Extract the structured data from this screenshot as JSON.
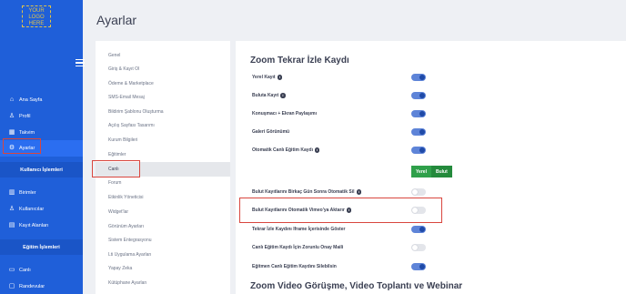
{
  "app": {
    "logo_text": "YOUR LOGO HERE"
  },
  "header": {
    "title": "Ayarlar"
  },
  "sidebar": {
    "items": [
      {
        "label": "Ana Sayfa",
        "icon": "home-icon"
      },
      {
        "label": "Profil",
        "icon": "user-icon"
      },
      {
        "label": "Takvim",
        "icon": "calendar-icon"
      },
      {
        "label": "Ayarlar",
        "icon": "gear-icon",
        "active": true
      }
    ],
    "section1": "Kullanıcı İşlemleri",
    "items2": [
      {
        "label": "Birimler",
        "icon": "building-icon"
      },
      {
        "label": "Kullanıcılar",
        "icon": "users-icon"
      },
      {
        "label": "Kayıt Alanları",
        "icon": "form-icon"
      }
    ],
    "section2": "Eğitim İşlemleri",
    "items3": [
      {
        "label": "Canlı",
        "icon": "video-icon"
      },
      {
        "label": "Randevular",
        "icon": "appointment-icon"
      }
    ]
  },
  "menu": {
    "items": [
      "Genel",
      "Giriş & Kayıt Ol",
      "Ödeme & Marketplace",
      "SMS-Email Mesaj",
      "Bildirim Şablonu Oluşturma",
      "Açılış Sayfası Tasarımı",
      "Kurum Bilgileri",
      "Eğitimler",
      "Canlı",
      "Forum",
      "Etkinlik Yöneticisi",
      "Widget'lar",
      "Görünüm Ayarları",
      "Sistem Entegrasyonu",
      "Lti Uygulama Ayarları",
      "Yapay Zeka",
      "Kütüphane Ayarları"
    ],
    "active": "Canlı"
  },
  "content": {
    "section_title": "Zoom Tekrar İzle Kaydı",
    "settings": [
      {
        "label": "Yerel Kayıt",
        "info": true,
        "on": true
      },
      {
        "label": "Buluta Kayıt",
        "info": true,
        "on": true
      },
      {
        "label": "Konuşmacı + Ekran Paylaşımı",
        "info": false,
        "on": true
      },
      {
        "label": "Galeri Görünümü",
        "info": false,
        "on": true
      },
      {
        "label": "Otomatik Canlı Eğitim Kaydı",
        "info": true,
        "on": true
      }
    ],
    "segment": {
      "option1": "Yerel",
      "option2": "Bulut"
    },
    "settings2": [
      {
        "label": "Bulut Kayıtlarını Birkaç Gün Sonra Otomatik Sil",
        "info": true,
        "on": false
      },
      {
        "label": "Bulut Kayıtlarını Otomatik Vimeo'ya Aktarır",
        "info": true,
        "on": false
      },
      {
        "label": "Tekrar İzle Kaydını Iframe İçerisinde Göster",
        "info": false,
        "on": true
      },
      {
        "label": "Canlı Eğitim Kaydı İçin Zorunlu Onay Maili",
        "info": false,
        "on": false
      },
      {
        "label": "Eğitmen Canlı Eğitim Kaydını Silebilsin",
        "info": false,
        "on": true
      }
    ],
    "section_title2": "Zoom Video Görüşme, Video Toplantı ve Webinar"
  },
  "colors": {
    "sidebar": "#1f5fd9",
    "accent": "#2b6ef0",
    "toggle_on": "#5e84d8",
    "segment": "#2fa04a",
    "highlight": "#d9463e"
  }
}
